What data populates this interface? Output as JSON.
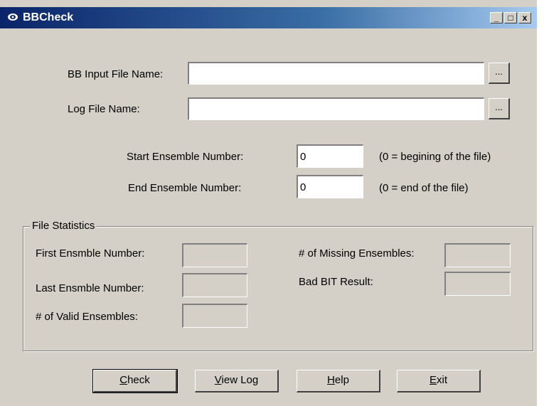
{
  "window": {
    "title": "BBCheck"
  },
  "titlebar_buttons": {
    "minimize": "_",
    "maximize": "□",
    "close": "x"
  },
  "input_file": {
    "label": "BB Input File Name:",
    "value": "",
    "browse": "..."
  },
  "log_file": {
    "label": "Log File Name:",
    "value": "",
    "browse": "..."
  },
  "start_ensemble": {
    "label": "Start Ensemble Number:",
    "value": "0",
    "hint": "(0 = begining of the file)"
  },
  "end_ensemble": {
    "label": "End Ensemble Number:",
    "value": "0",
    "hint": "(0 = end of the file)"
  },
  "stats": {
    "group_title": "File Statistics",
    "first_label": "First Ensmble Number:",
    "first_value": "",
    "last_label": "Last Ensmble Number:",
    "last_value": "",
    "valid_label": "# of Valid Ensembles:",
    "valid_value": "",
    "missing_label": "# of Missing Ensembles:",
    "missing_value": "",
    "badbit_label": "Bad BIT Result:",
    "badbit_value": ""
  },
  "buttons": {
    "check": {
      "mnemonic": "C",
      "rest": "heck"
    },
    "view_log": {
      "mnemonic": "V",
      "rest": "iew Log"
    },
    "help": {
      "mnemonic": "H",
      "rest": "elp"
    },
    "exit": {
      "mnemonic": "E",
      "rest": "xit"
    }
  }
}
